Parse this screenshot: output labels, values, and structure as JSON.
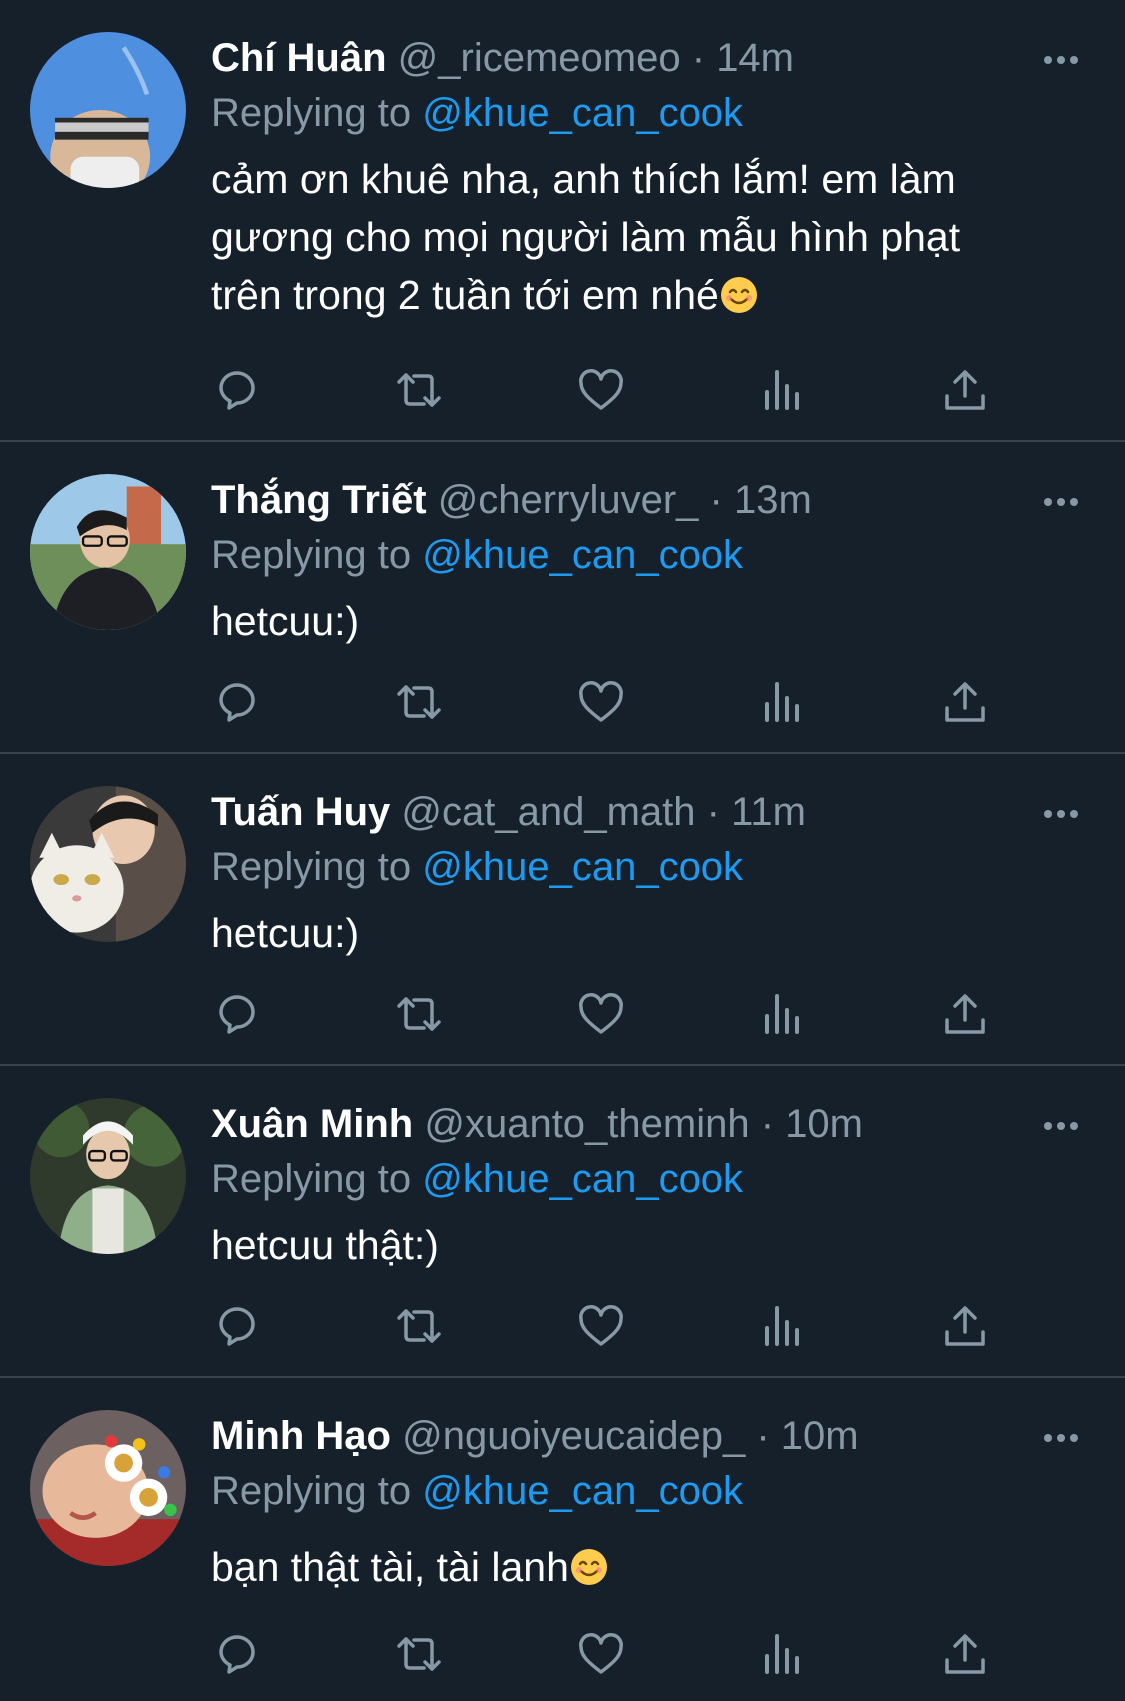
{
  "colors": {
    "background": "#15202b",
    "divider": "#38444d",
    "secondary_text": "#8899a6",
    "mention": "#1d9bf0",
    "primary_text": "#ffffff"
  },
  "icons": {
    "reply": "speech-bubble-icon",
    "retweet": "retweet-icon",
    "like": "heart-icon",
    "analytics": "bar-chart-icon",
    "share": "share-icon",
    "more": "more-dots-icon"
  },
  "tweets": [
    {
      "name": "Chí Huân",
      "handle": "@_ricemeomeo",
      "dot": "·",
      "time": "14m",
      "replying_prefix": "Replying to ",
      "replying_to": "@khue_can_cook",
      "text": "cảm ơn khuê nha, anh thích lắm! em làm gương cho mọi người làm mẫu hình phạt trên trong 2 tuần tới em nhé",
      "emoji": "smiling-face-emoji"
    },
    {
      "name": "Thắng Triết",
      "handle": "@cherryluver_",
      "dot": "·",
      "time": "13m",
      "replying_prefix": "Replying to ",
      "replying_to": "@khue_can_cook",
      "text": "hetcuu:)"
    },
    {
      "name": "Tuấn Huy",
      "handle": "@cat_and_math",
      "dot": "·",
      "time": "11m",
      "replying_prefix": "Replying to ",
      "replying_to": "@khue_can_cook",
      "text": "hetcuu:)"
    },
    {
      "name": "Xuân Minh",
      "handle": "@xuanto_theminh",
      "dot": "·",
      "time": "10m",
      "replying_prefix": "Replying to ",
      "replying_to": "@khue_can_cook",
      "text": "hetcuu thật:)"
    },
    {
      "name": "Minh Hạo",
      "handle": "@nguoiyeucaidep_",
      "dot": "·",
      "time": "10m",
      "replying_prefix": "Replying to ",
      "replying_to": "@khue_can_cook",
      "text": "bạn thật tài, tài lanh",
      "emoji": "smiling-face-emoji"
    }
  ]
}
